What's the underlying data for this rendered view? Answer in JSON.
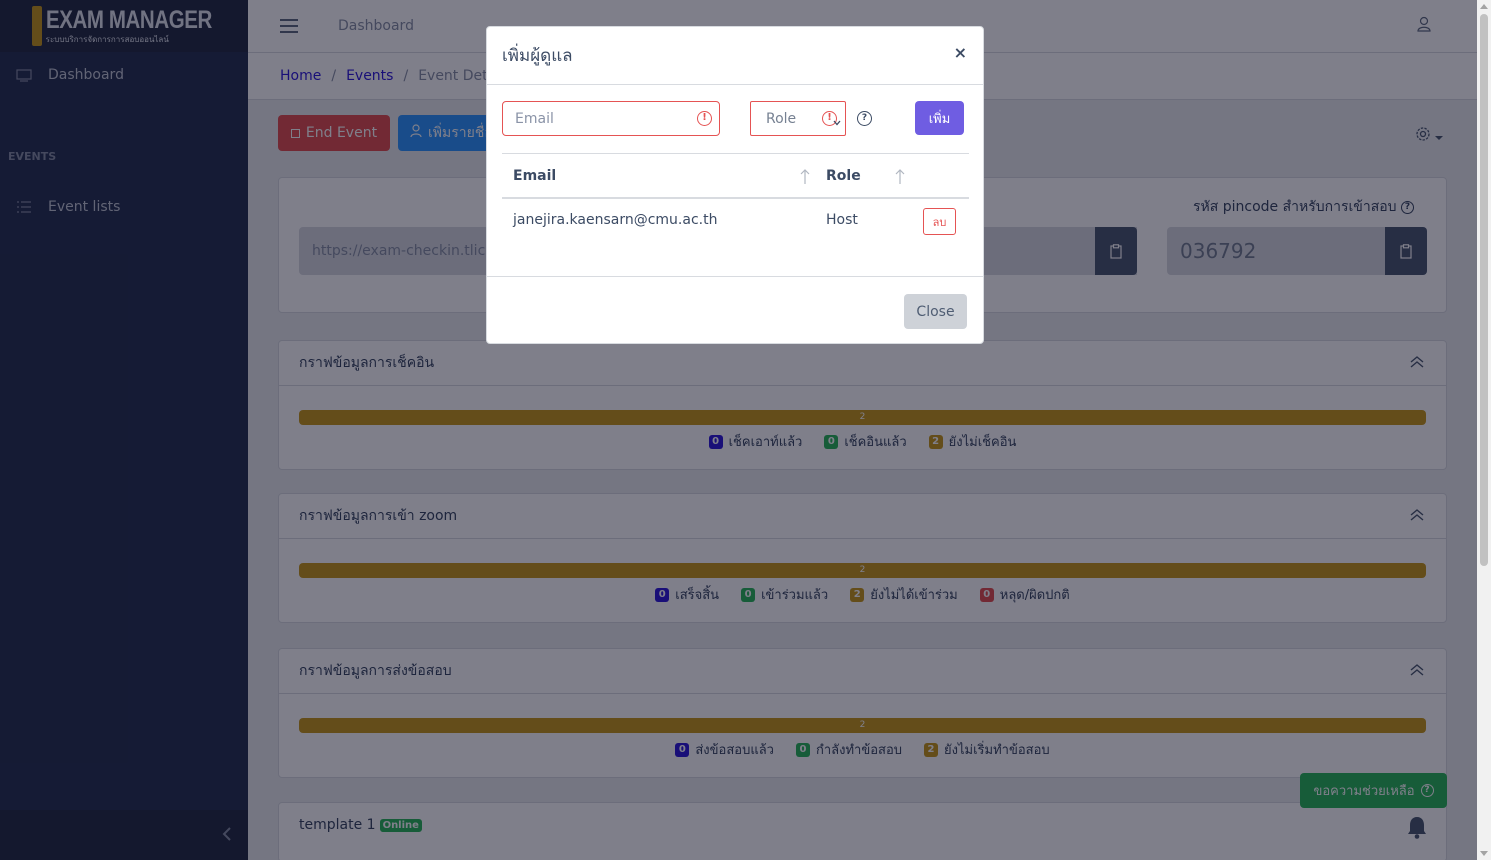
{
  "brand": {
    "title": "EXAM MANAGER",
    "subtitle": "ระบบบริการจัดการการสอบออนไลน์"
  },
  "sidebar": {
    "dashboard": "Dashboard",
    "section_title": "EVENTS",
    "event_lists": "Event lists"
  },
  "header": {
    "nav": "Dashboard"
  },
  "breadcrumb": {
    "home": "Home",
    "events": "Events",
    "current": "Event Detail"
  },
  "toolbar": {
    "end_event": "End Event",
    "add_list": "เพิ่มรายชื่อ"
  },
  "link_card": {
    "url": "https://exam-checkin.tlic.cmu.ac.th",
    "pin_label": "รหัส pincode สำหรับการเข้าสอบ",
    "pincode": "036792"
  },
  "charts": [
    {
      "title": "กราฟข้อมูลการเช็คอิน",
      "bar_label": "2",
      "legend": [
        {
          "count": "0",
          "label": "เช็คเอาท์แล้ว",
          "color": "blue"
        },
        {
          "count": "0",
          "label": "เช็คอินแล้ว",
          "color": "green"
        },
        {
          "count": "2",
          "label": "ยังไม่เช็คอิน",
          "color": "yellow"
        }
      ]
    },
    {
      "title": "กราฟข้อมูลการเข้า zoom",
      "bar_label": "2",
      "legend": [
        {
          "count": "0",
          "label": "เสร็จสิ้น",
          "color": "blue"
        },
        {
          "count": "0",
          "label": "เข้าร่วมแล้ว",
          "color": "green"
        },
        {
          "count": "2",
          "label": "ยังไม่ได้เข้าร่วม",
          "color": "yellow"
        },
        {
          "count": "0",
          "label": "หลุด/ผิดปกติ",
          "color": "red"
        }
      ]
    },
    {
      "title": "กราฟข้อมูลการส่งข้อสอบ",
      "bar_label": "2",
      "legend": [
        {
          "count": "0",
          "label": "ส่งข้อสอบแล้ว",
          "color": "blue"
        },
        {
          "count": "0",
          "label": "กำลังทำข้อสอบ",
          "color": "green"
        },
        {
          "count": "2",
          "label": "ยังไม่เริ่มทำข้อสอบ",
          "color": "yellow"
        }
      ]
    }
  ],
  "template_card": {
    "title": "template 1",
    "status": "Online"
  },
  "help_button": "ขอความช่วยเหลือ",
  "modal": {
    "title": "เพิ่มผู้ดูแล",
    "close_x": "×",
    "email_placeholder": "Email",
    "role_placeholder": "Role",
    "add_button": "เพิ่ม",
    "columns": {
      "email": "Email",
      "role": "Role"
    },
    "rows": [
      {
        "email": "janejira.kaensarn@cmu.ac.th",
        "role": "Host",
        "action": "ลบ"
      }
    ],
    "close_button": "Close"
  }
}
